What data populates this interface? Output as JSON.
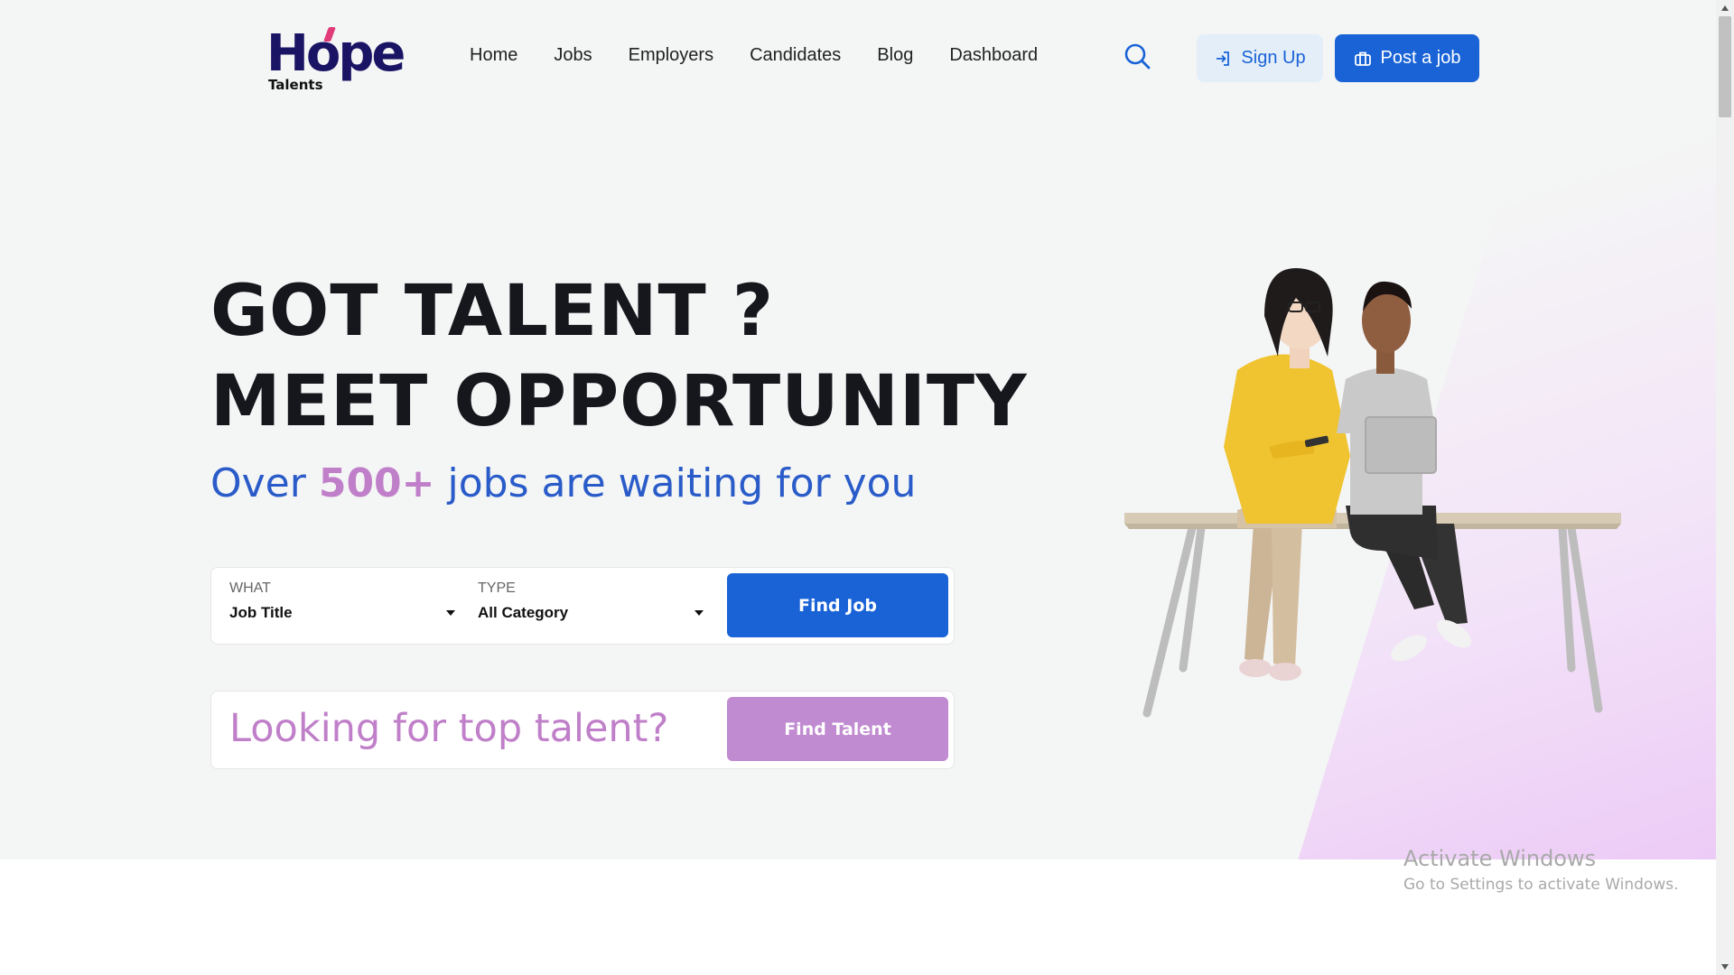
{
  "header": {
    "logo_main": "Hope",
    "logo_sub": "Talents",
    "nav": [
      "Home",
      "Jobs",
      "Employers",
      "Candidates",
      "Blog",
      "Dashboard"
    ],
    "signup_label": "Sign Up",
    "post_job_label": "Post a job"
  },
  "hero": {
    "headline_line1": "GOT TALENT ?",
    "headline_line2": "MEET OPPORTUNITY",
    "sub_before": "Over ",
    "sub_highlight": "500+",
    "sub_after": " jobs are waiting for you"
  },
  "search": {
    "what_label": "WHAT",
    "what_value": "Job Title",
    "type_label": "TYPE",
    "type_value": "All Category",
    "find_job_label": "Find Job"
  },
  "talent": {
    "prompt": "Looking for top talent?",
    "button_label": "Find Talent"
  },
  "watermark": {
    "title": "Activate Windows",
    "subtitle": "Go to Settings to activate Windows."
  },
  "colors": {
    "primary": "#1963d6",
    "accent_purple": "#c07fc9",
    "hero_bg": "#f4f5f5",
    "logo_navy": "#1a1464"
  },
  "icons": {
    "search": "search-icon",
    "signup": "login-arrow-icon",
    "post_job": "briefcase-icon",
    "dropdown": "caret-down-icon"
  }
}
